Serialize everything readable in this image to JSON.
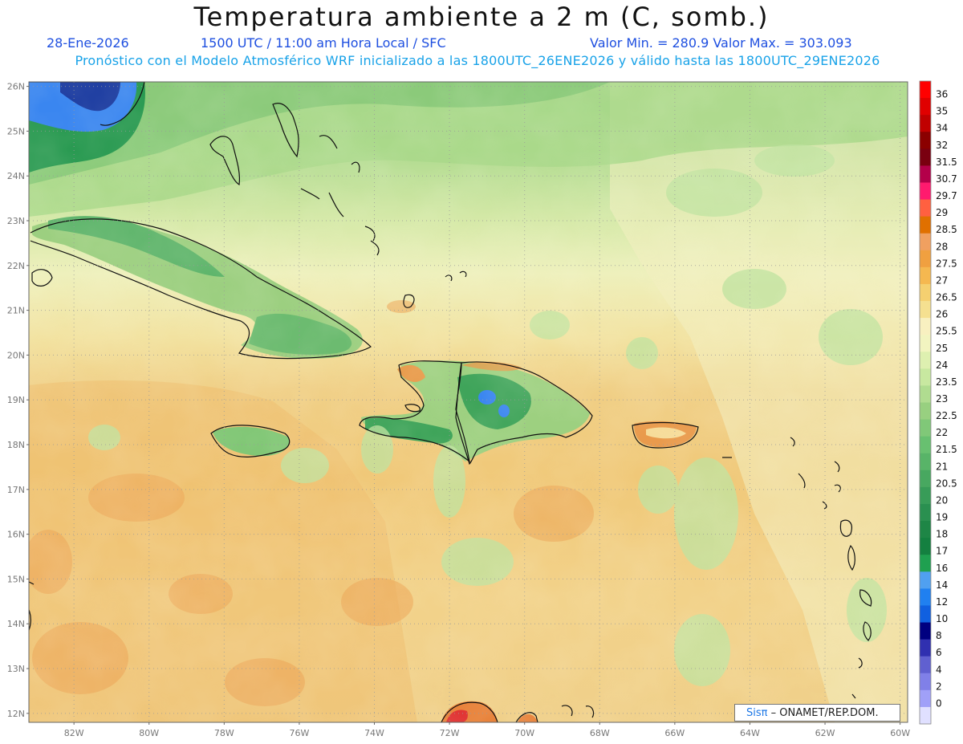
{
  "title": "Temperatura ambiente a 2 m (C, somb.)",
  "info": {
    "date": "28-Ene-2026",
    "time": "1500 UTC / 11:00 am Hora Local / SFC",
    "minmax": "Valor Min. = 280.9   Valor Max. = 303.093"
  },
  "subtitle": "Pronóstico con el Modelo Atmosférico WRF inicializado a las 1800UTC_26ENE2026 y válido hasta las  1800UTC_29ENE2026",
  "credit": {
    "sis": "Sisπ",
    "rest": " – ONAMET/REP.DOM."
  },
  "axes": {
    "lat_labels": [
      "26N",
      "25N",
      "24N",
      "23N",
      "22N",
      "21N",
      "20N",
      "19N",
      "18N",
      "17N",
      "16N",
      "15N",
      "14N",
      "13N",
      "12N"
    ],
    "lon_labels": [
      "82W",
      "80W",
      "78W",
      "76W",
      "74W",
      "72W",
      "70W",
      "68W",
      "66W",
      "64W",
      "62W",
      "60W"
    ]
  },
  "colorbar": {
    "labels": [
      "36",
      "35",
      "34",
      "32",
      "31.5",
      "30.7",
      "29.7",
      "29",
      "28.5",
      "28",
      "27.5",
      "27",
      "26.5",
      "26",
      "25.5",
      "25",
      "24",
      "23.5",
      "23",
      "22.5",
      "22",
      "21.5",
      "21",
      "20.5",
      "20",
      "19",
      "18",
      "17",
      "16",
      "14",
      "12",
      "10",
      "8",
      "6",
      "4",
      "2",
      "0"
    ],
    "colors": [
      "#ff0000",
      "#e00000",
      "#c00000",
      "#8b0000",
      "#7a0010",
      "#b4004a",
      "#ff1a6e",
      "#ff6040",
      "#e07000",
      "#f0a060",
      "#f0a040",
      "#f5b850",
      "#f5d070",
      "#f5e090",
      "#f8f0c0",
      "#f2f4c0",
      "#def0b0",
      "#c8e8a0",
      "#b0dc90",
      "#98d080",
      "#80c878",
      "#68c070",
      "#58b468",
      "#48a860",
      "#389c58",
      "#2a9050",
      "#1e8646",
      "#148040",
      "#1fa050",
      "#50a0f0",
      "#2080f0",
      "#1060e0",
      "#000080",
      "#3030b0",
      "#6060d0",
      "#8080e8",
      "#a0a0f8",
      "#e0e0ff"
    ]
  },
  "map": {
    "region": "Caribe",
    "extent": {
      "lon": [
        -83.2,
        -59.8
      ],
      "lat": [
        11.8,
        26.1
      ]
    }
  }
}
